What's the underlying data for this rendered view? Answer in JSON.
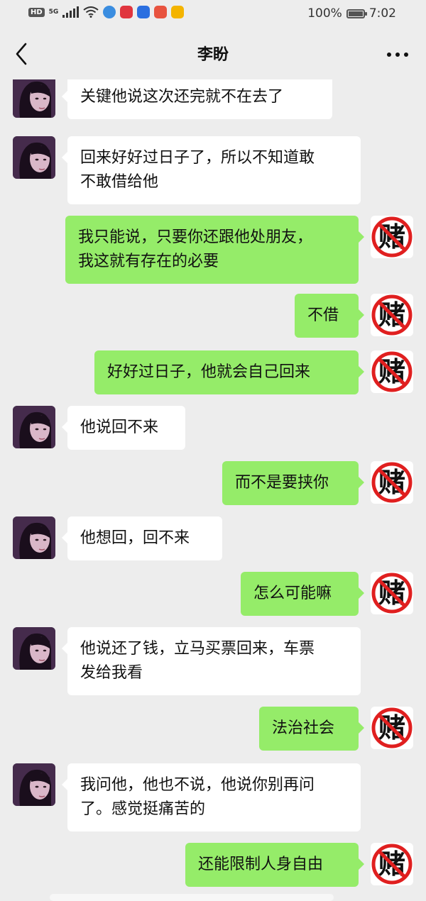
{
  "status_bar": {
    "hd": "HD",
    "network": "5G",
    "battery_text": "100%",
    "battery_level": 1.0,
    "time": "7:02"
  },
  "nav": {
    "title": "李盼",
    "back_icon": "chevron-left-icon",
    "more_icon": "more-dots-icon"
  },
  "colors": {
    "background": "#ededed",
    "incoming_bubble": "#ffffff",
    "outgoing_bubble": "#95ec69"
  },
  "messages": [
    {
      "side": "in",
      "text": "关键他说这次还完就不在去了"
    },
    {
      "side": "in",
      "text": "回来好好过日子了，所以不知道敢\n不敢借给他"
    },
    {
      "side": "out",
      "text": "我只能说，只要你还跟他处朋友，\n我这就有存在的必要"
    },
    {
      "side": "out",
      "text": "不借"
    },
    {
      "side": "out",
      "text": "好好过日子，他就会自己回来"
    },
    {
      "side": "in",
      "text": "他说回不来"
    },
    {
      "side": "out",
      "text": "而不是要挟你"
    },
    {
      "side": "in",
      "text": "他想回，回不来"
    },
    {
      "side": "out",
      "text": "怎么可能嘛"
    },
    {
      "side": "in",
      "text": "他说还了钱，立马买票回来，车票\n发给我看"
    },
    {
      "side": "out",
      "text": "法治社会"
    },
    {
      "side": "in",
      "text": "我问他，他也不说，他说你别再问\n了。感觉挺痛苦的"
    },
    {
      "side": "out",
      "text": "还能限制人身自由"
    }
  ],
  "avatars": {
    "incoming": "woman-portrait-avatar",
    "outgoing": "no-gambling-sign-avatar",
    "outgoing_glyph": "赌"
  }
}
